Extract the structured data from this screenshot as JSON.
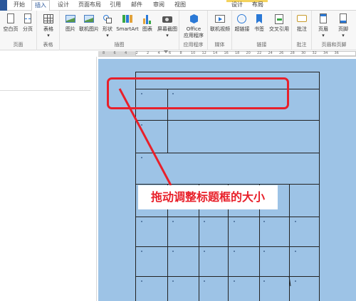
{
  "tabs": [
    {
      "label": "开始",
      "active": false
    },
    {
      "label": "插入",
      "active": true
    },
    {
      "label": "设计",
      "active": false
    },
    {
      "label": "页面布局",
      "active": false
    },
    {
      "label": "引用",
      "active": false
    },
    {
      "label": "邮件",
      "active": false
    },
    {
      "label": "审阅",
      "active": false
    },
    {
      "label": "视图",
      "active": false
    }
  ],
  "context_tabs": [
    {
      "label": "设计"
    },
    {
      "label": "布局"
    }
  ],
  "ribbon": {
    "groups": [
      {
        "label": "页面",
        "buttons": [
          {
            "label": "空白页",
            "icon": "blank-page-icon"
          },
          {
            "label": "分页",
            "icon": "page-break-icon"
          }
        ]
      },
      {
        "label": "表格",
        "buttons": [
          {
            "label": "表格",
            "icon": "table-icon"
          }
        ]
      },
      {
        "label": "插图",
        "buttons": [
          {
            "label": "图片",
            "icon": "picture-icon"
          },
          {
            "label": "联机图片",
            "icon": "online-picture-icon"
          },
          {
            "label": "形状",
            "icon": "shapes-icon"
          },
          {
            "label": "SmartArt",
            "icon": "smartart-icon"
          },
          {
            "label": "图表",
            "icon": "chart-icon"
          },
          {
            "label": "屏幕截图",
            "icon": "screenshot-icon"
          }
        ]
      },
      {
        "label": "应用程序",
        "buttons": [
          {
            "label": "Office",
            "label2": "应用程序",
            "icon": "office-apps-icon"
          }
        ]
      },
      {
        "label": "媒体",
        "buttons": [
          {
            "label": "联机视频",
            "icon": "online-video-icon"
          }
        ]
      },
      {
        "label": "链接",
        "buttons": [
          {
            "label": "超链接",
            "icon": "hyperlink-icon"
          },
          {
            "label": "书签",
            "icon": "bookmark-icon"
          },
          {
            "label": "交叉引用",
            "icon": "cross-reference-icon"
          }
        ]
      },
      {
        "label": "批注",
        "buttons": [
          {
            "label": "批注",
            "icon": "comment-icon"
          }
        ]
      },
      {
        "label": "页眉和页脚",
        "buttons": [
          {
            "label": "页眉",
            "icon": "header-icon"
          },
          {
            "label": "页脚",
            "icon": "footer-icon"
          }
        ]
      }
    ]
  },
  "ruler": {
    "numbers": [
      "8",
      "6",
      "4",
      "2",
      "2",
      "4",
      "6",
      "8",
      "10",
      "12",
      "14",
      "16",
      "18",
      "20",
      "22",
      "24",
      "26",
      "28",
      "30",
      "32",
      "34",
      "36"
    ]
  },
  "annotation": {
    "label": "拖动调整标题框的大小",
    "color": "#e8202a"
  },
  "colors": {
    "page_fill": "#9dc3e6",
    "accent": "#2b579a",
    "context_tab": "#f4d35e"
  }
}
